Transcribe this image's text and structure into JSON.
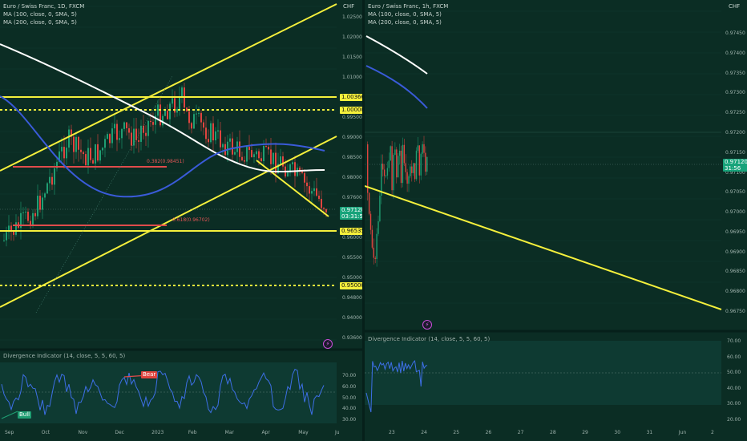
{
  "left": {
    "legend": {
      "symbol": "Euro / Swiss Franc, 1D, FXCM",
      "ma1": "MA (100, close, 0, SMA, 5)",
      "ma2": "MA (200, close, 0, SMA, 5)"
    },
    "currency": "CHF",
    "y_ticks": [
      "1.02500",
      "1.02000",
      "1.01500",
      "1.01000",
      "1.00500",
      "0.99500",
      "0.99000",
      "0.98500",
      "0.98000",
      "0.97600",
      "0.97000",
      "0.96000",
      "0.95500",
      "0.95000",
      "0.94800",
      "0.94000",
      "0.93600"
    ],
    "x_ticks": [
      "Sep",
      "Oct",
      "Nov",
      "Dec",
      "2023",
      "Feb",
      "Mar",
      "Apr",
      "May",
      "Ju"
    ],
    "price_badges": {
      "p1": "1.00366",
      "p2": "1.00000",
      "price": "0.97120",
      "countdown": "03:31:56",
      "p3": "0.96535",
      "p4": "0.95000"
    },
    "fib_labels": {
      "f1": "0.382(0.98451)",
      "f2": "0.618(0.96702)"
    },
    "osc": {
      "title": "Divergence Indicator (14, close, 5, 5, 60, 5)",
      "y_ticks": [
        "70.00",
        "60.00",
        "50.00",
        "40.00",
        "30.00"
      ],
      "bear_label": "Bear",
      "bull_label": "Bull"
    },
    "bolt_icon": "lightning-icon"
  },
  "right": {
    "legend": {
      "symbol": "Euro / Swiss Franc, 1h, FXCM",
      "ma1": "MA (100, close, 0, SMA, 5)",
      "ma2": "MA (200, close, 0, SMA, 5)"
    },
    "currency": "CHF",
    "y_ticks": [
      "0.97450",
      "0.97400",
      "0.97350",
      "0.97300",
      "0.97250",
      "0.97200",
      "0.97150",
      "0.97100",
      "0.97050",
      "0.97000",
      "0.96950",
      "0.96900",
      "0.96850",
      "0.96800",
      "0.96750"
    ],
    "x_ticks": [
      "23",
      "24",
      "25",
      "26",
      "27",
      "28",
      "29",
      "30",
      "31",
      "Jun",
      "2"
    ],
    "price_badges": {
      "price": "0.97120",
      "countdown": "31:56"
    },
    "osc": {
      "title": "Divergence Indicator (14, close, 5, 5, 60, 5)",
      "y_ticks": [
        "70.00",
        "60.00",
        "50.00",
        "40.00",
        "30.00",
        "20.00"
      ]
    },
    "bolt_icon": "lightning-icon"
  },
  "colors": {
    "background": "#0b2d24",
    "trendline": "#f5f03c",
    "ma100": "#3a5bd9",
    "ma200": "#ffffff",
    "up_candle": "#1f9e72",
    "down_candle": "#e0443f",
    "osc_line": "#3d6fe6",
    "price_badge": "#17a37a"
  }
}
